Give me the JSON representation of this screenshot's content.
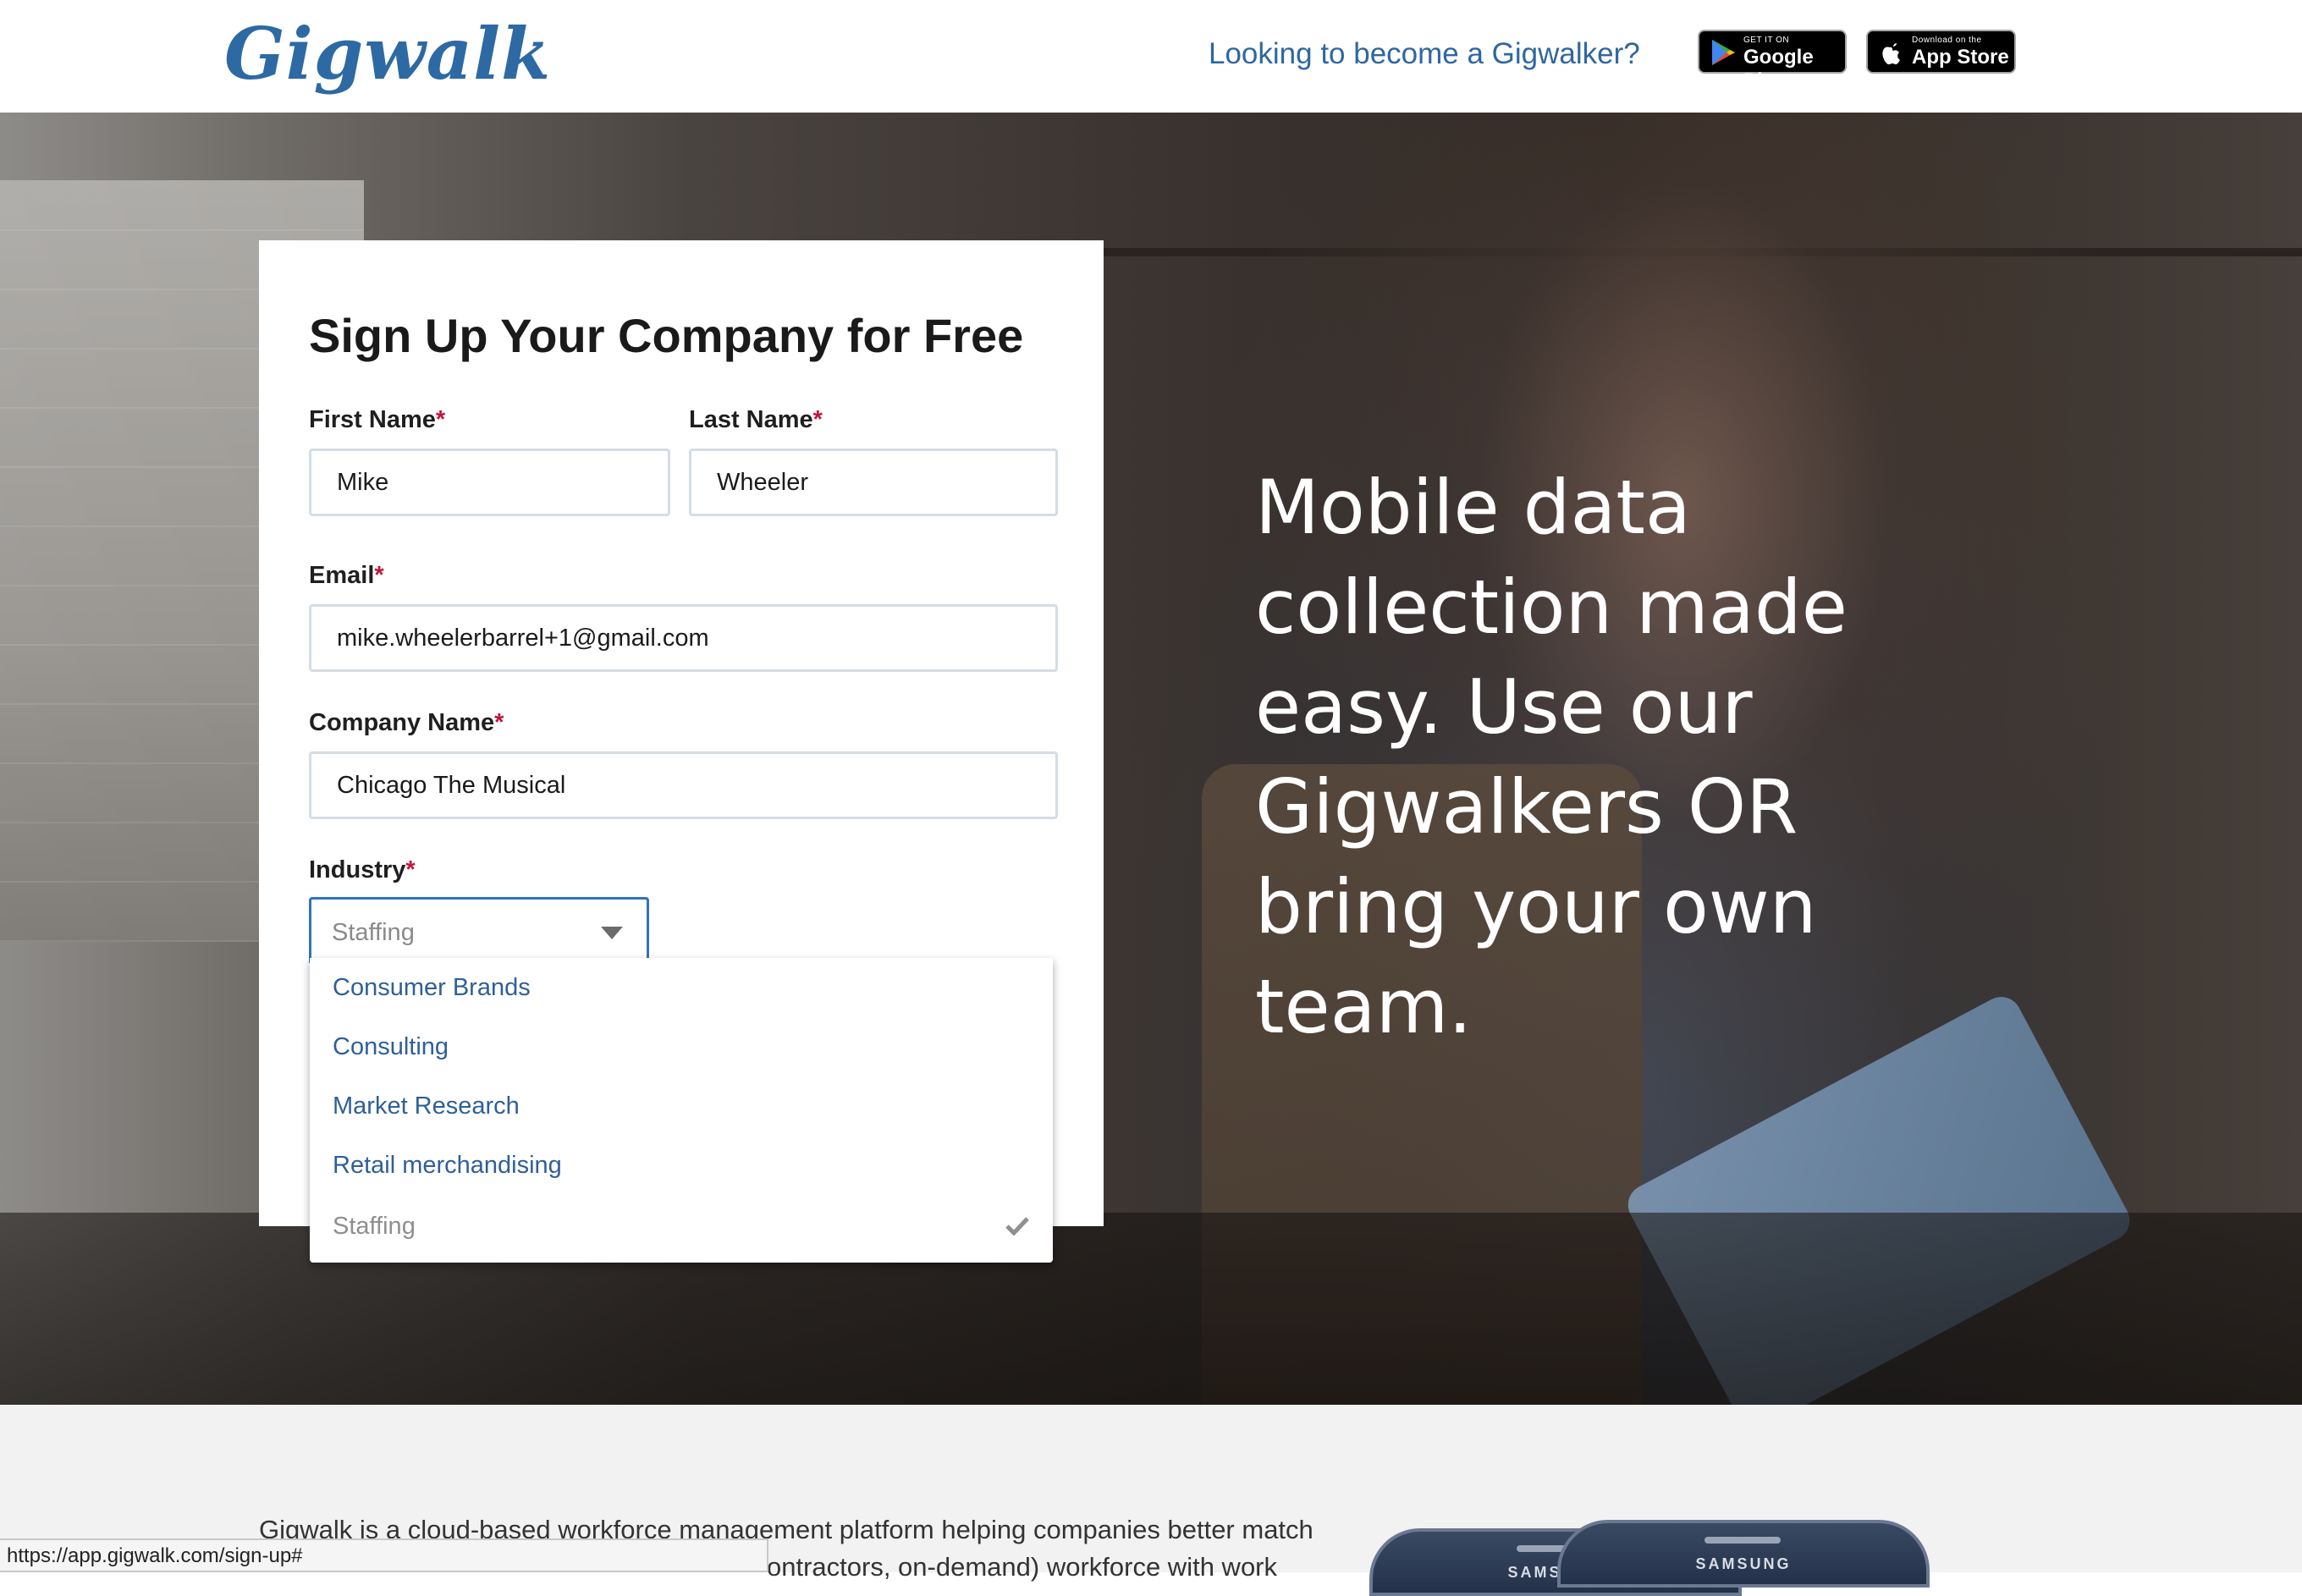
{
  "header": {
    "logo_text": "Gigwalk",
    "walker_link": "Looking to become a Gigwalker?",
    "google_badge": {
      "small": "GET IT ON",
      "big": "Google Play",
      "icon": "google-play-icon"
    },
    "apple_badge": {
      "small": "Download on the",
      "big": "App Store",
      "icon": "apple-icon"
    }
  },
  "hero": {
    "headline": "Mobile data collection made easy. Use our Gigwalkers OR bring your own team."
  },
  "form": {
    "title": "Sign Up Your Company for Free",
    "required_marker": "*",
    "first_name": {
      "label": "First Name",
      "value": "Mike"
    },
    "last_name": {
      "label": "Last Name",
      "value": "Wheeler"
    },
    "email": {
      "label": "Email",
      "value": "mike.wheelerbarrel+1@gmail.com"
    },
    "company": {
      "label": "Company Name",
      "value": "Chicago The Musical"
    },
    "industry": {
      "label": "Industry",
      "selected": "Staffing",
      "options": [
        "Consumer Brands",
        "Consulting",
        "Market Research",
        "Retail merchandising",
        "Staffing"
      ]
    }
  },
  "about": {
    "text": "Gigwalk is a cloud-based workforce management platform helping companies better match",
    "text2": "ontractors, on-demand) workforce with work"
  },
  "phones": {
    "brand": "SAMSUNG"
  },
  "status_bar": {
    "url": "https://app.gigwalk.com/sign-up#"
  },
  "colors": {
    "brand_blue": "#2d6aa3",
    "link_blue": "#2f67a0",
    "required_red": "#c0163a",
    "focus_blue": "#2f72c4"
  }
}
